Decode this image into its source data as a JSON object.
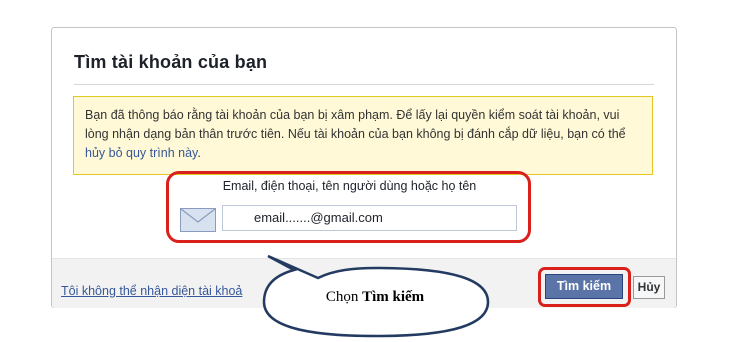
{
  "dialog": {
    "title": "Tìm tài khoản của bạn",
    "notice": {
      "text": "Bạn đã thông báo rằng tài khoản của bạn bị xâm phạm. Để lấy lại quyền kiểm soát tài khoản, vui lòng nhận dạng bản thân trước tiên. Nếu tài khoản của bạn không bị đánh cắp dữ liệu, bạn có thể ",
      "link": "hủy bỏ quy trình này",
      "end": "."
    },
    "field_label": "Email, điện thoại, tên người dùng hoặc họ tên",
    "email_value": "email.......@gmail.com",
    "footer_link": "Tôi không thể nhận diện tài khoả",
    "search_button": "Tìm kiếm",
    "cancel_button": "Hủy"
  },
  "callout": {
    "prefix": "Chọn ",
    "bold": "Tìm kiếm"
  },
  "colors": {
    "notice_bg": "#fff9d7",
    "notice_border": "#e2c822",
    "highlight": "#d9201b",
    "button_blue": "#5b74a8",
    "link": "#365899"
  },
  "icons": {
    "mail": "mail-icon"
  }
}
